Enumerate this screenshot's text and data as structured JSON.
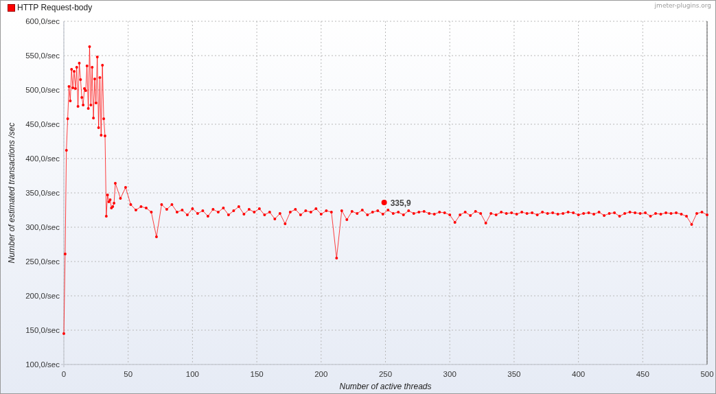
{
  "watermark": "jmeter-plugins.org",
  "chart_data": {
    "type": "line",
    "xlabel": "Number of active threads",
    "ylabel": "Number of estimated transactions /sec",
    "grid": true,
    "xlim": [
      0,
      500
    ],
    "ylim": [
      100,
      600
    ],
    "xticks": [
      0,
      50,
      100,
      150,
      200,
      250,
      300,
      350,
      400,
      450,
      500
    ],
    "yticks": [
      {
        "value": 100,
        "label": "100,0/sec"
      },
      {
        "value": 150,
        "label": "150,0/sec"
      },
      {
        "value": 200,
        "label": "200,0/sec"
      },
      {
        "value": 250,
        "label": "250,0/sec"
      },
      {
        "value": 300,
        "label": "300,0/sec"
      },
      {
        "value": 350,
        "label": "350,0/sec"
      },
      {
        "value": 400,
        "label": "400,0/sec"
      },
      {
        "value": 450,
        "label": "450,0/sec"
      },
      {
        "value": 500,
        "label": "500,0/sec"
      },
      {
        "value": 550,
        "label": "550,0/sec"
      },
      {
        "value": 600,
        "label": "600,0/sec"
      }
    ],
    "x": [
      0,
      1,
      2,
      3,
      4,
      5,
      6,
      7,
      8,
      9,
      10,
      11,
      12,
      13,
      14,
      15,
      16,
      17,
      18,
      19,
      20,
      21,
      22,
      23,
      24,
      25,
      26,
      27,
      28,
      29,
      30,
      31,
      32,
      33,
      34,
      35,
      36,
      37,
      38,
      39,
      40,
      44,
      48,
      52,
      56,
      60,
      64,
      68,
      72,
      76,
      80,
      84,
      88,
      92,
      96,
      100,
      104,
      108,
      112,
      116,
      120,
      124,
      128,
      132,
      136,
      140,
      144,
      148,
      152,
      156,
      160,
      164,
      168,
      172,
      176,
      180,
      184,
      188,
      192,
      196,
      200,
      204,
      208,
      212,
      216,
      220,
      224,
      228,
      232,
      236,
      240,
      244,
      248,
      252,
      256,
      260,
      264,
      268,
      272,
      276,
      280,
      284,
      288,
      292,
      296,
      300,
      304,
      308,
      312,
      316,
      320,
      324,
      328,
      332,
      336,
      340,
      344,
      348,
      352,
      356,
      360,
      364,
      368,
      372,
      376,
      380,
      384,
      388,
      392,
      396,
      400,
      404,
      408,
      412,
      416,
      420,
      424,
      428,
      432,
      436,
      440,
      444,
      448,
      452,
      456,
      460,
      464,
      468,
      472,
      476,
      480,
      484,
      488,
      492,
      496,
      500
    ],
    "series": [
      {
        "name": "HTTP Request-body",
        "color": "#ff0000",
        "values": [
          145,
          261,
          412,
          458,
          505,
          484,
          530,
          503,
          527,
          502,
          533,
          476,
          539,
          515,
          489,
          478,
          502,
          499,
          535,
          473,
          563,
          478,
          533,
          459,
          516,
          481,
          548,
          445,
          518,
          434,
          536,
          458,
          433,
          316,
          347,
          337,
          340,
          328,
          330,
          335,
          364,
          342,
          358,
          333,
          325,
          330,
          328,
          322,
          286,
          333,
          326,
          333,
          322,
          325,
          318,
          327,
          320,
          324,
          316,
          326,
          322,
          328,
          318,
          324,
          330,
          319,
          326,
          322,
          327,
          318,
          322,
          312,
          320,
          305,
          322,
          326,
          318,
          324,
          322,
          327,
          319,
          324,
          322,
          255,
          324,
          311,
          323,
          320,
          325,
          318,
          322,
          324,
          319,
          325,
          320,
          322,
          318,
          324,
          320,
          322,
          323,
          320,
          319,
          322,
          321,
          318,
          307,
          318,
          322,
          317,
          323,
          320,
          306,
          320,
          318,
          322,
          320,
          321,
          319,
          322,
          320,
          321,
          318,
          322,
          320,
          321,
          319,
          320,
          322,
          321,
          318,
          320,
          321,
          319,
          322,
          317,
          320,
          321,
          316,
          320,
          322,
          321,
          320,
          321,
          316,
          320,
          319,
          321,
          320,
          321,
          319,
          316,
          304,
          320,
          322,
          318
        ]
      }
    ],
    "annotations": [
      {
        "x": 249,
        "y": 335.9,
        "text": "335,9"
      }
    ]
  }
}
